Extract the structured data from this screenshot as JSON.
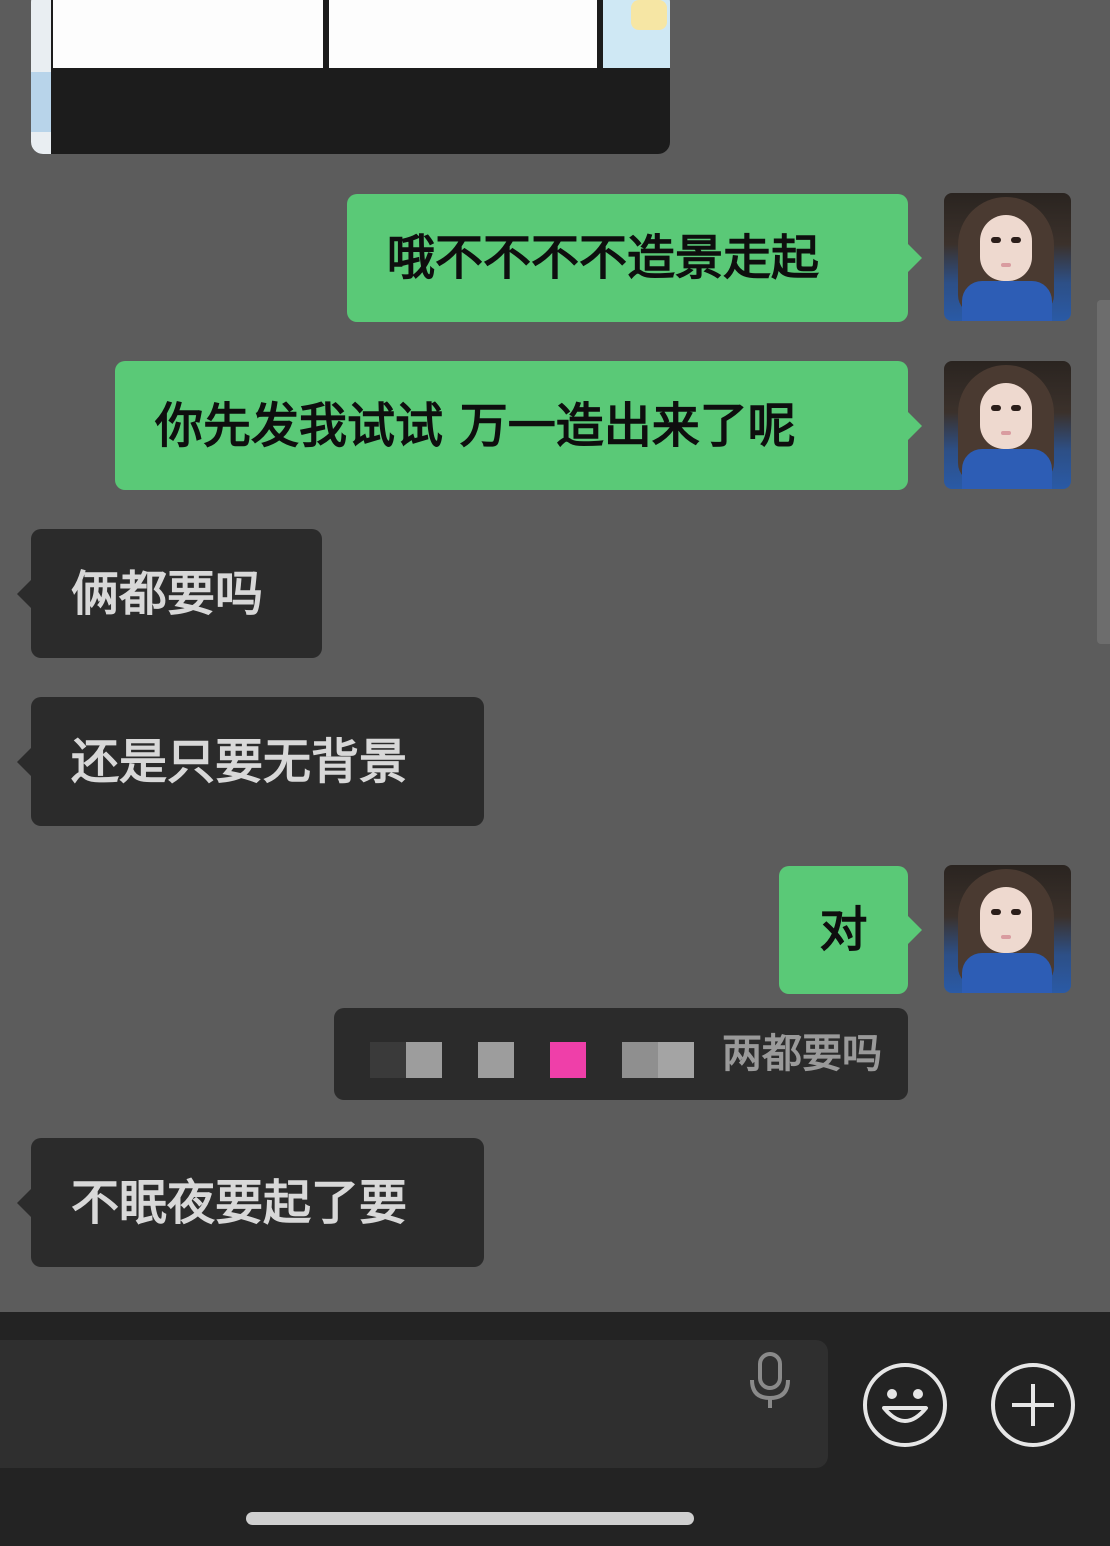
{
  "messages": [
    {
      "id": "m1",
      "direction": "sent",
      "text": "哦不不不不造景走起"
    },
    {
      "id": "m2",
      "direction": "sent",
      "text": "你先发我试试 万一造出来了呢"
    },
    {
      "id": "m3",
      "direction": "received",
      "text": "俩都要吗"
    },
    {
      "id": "m4",
      "direction": "received",
      "text": "还是只要无背景"
    },
    {
      "id": "m5",
      "direction": "sent",
      "text": "对"
    },
    {
      "id": "m6",
      "direction": "received",
      "text": "不眠夜要起了要"
    }
  ],
  "quote": {
    "text": "两都要吗",
    "redacted_colors": [
      "#3a3a3a",
      "#9d9d9d",
      "#9d9d9d",
      "#ef3fa9",
      "#8f8f8f",
      "#a4a4a4"
    ]
  },
  "colors": {
    "sent_bubble": "#5ac977",
    "received_bubble": "#2b2b2b",
    "chat_background": "#5c5c5c",
    "input_bar": "#232323"
  },
  "icons": {
    "mic": "microphone-icon",
    "emoji": "smile-emoji-icon",
    "plus": "plus-circle-icon"
  }
}
